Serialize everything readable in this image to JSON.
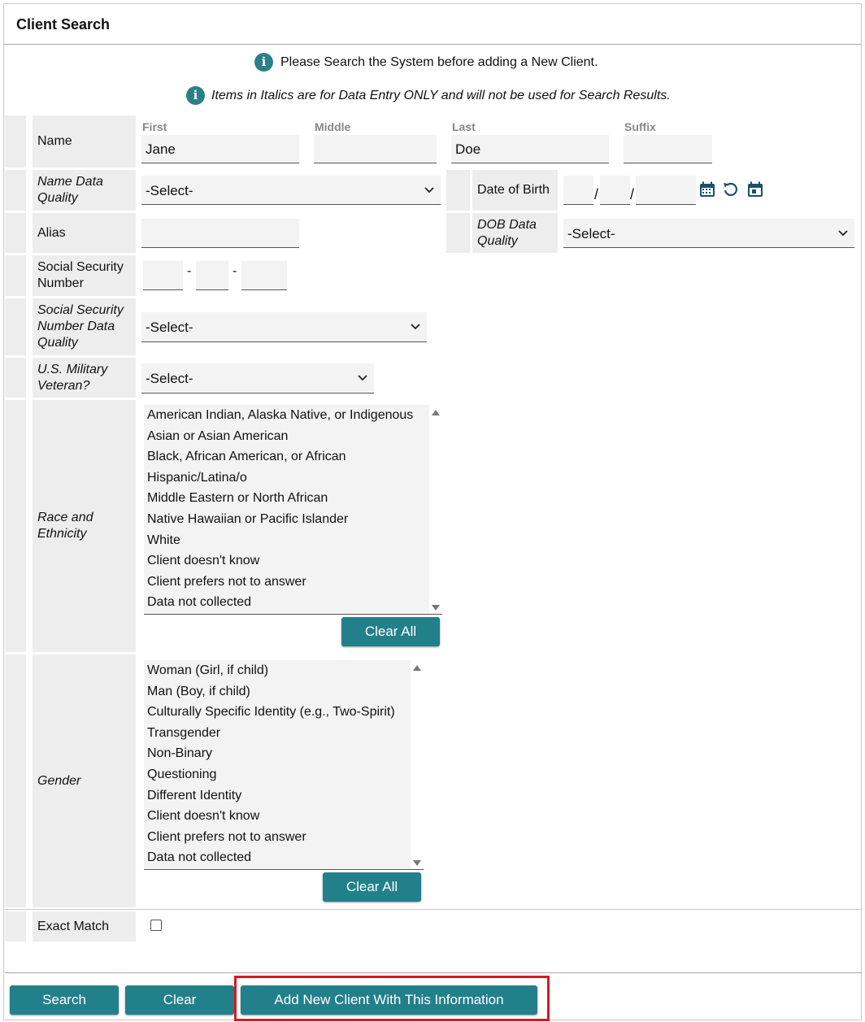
{
  "panel": {
    "title": "Client Search"
  },
  "info": {
    "search_notice": "Please Search the System before adding a New Client.",
    "italics_notice": "Items in Italics are for Data Entry ONLY and will not be used for Search Results."
  },
  "name": {
    "label": "Name",
    "first_label": "First",
    "first_value": "Jane",
    "middle_label": "Middle",
    "middle_value": "",
    "last_label": "Last",
    "last_value": "Doe",
    "suffix_label": "Suffix",
    "suffix_value": ""
  },
  "name_quality": {
    "label": "Name Data Quality",
    "value": "-Select-"
  },
  "dob": {
    "label": "Date of Birth",
    "month": "",
    "day": "",
    "year": ""
  },
  "alias": {
    "label": "Alias",
    "value": ""
  },
  "dob_quality": {
    "label": "DOB Data Quality",
    "value": "-Select-"
  },
  "ssn": {
    "label": "Social Security Number",
    "part1": "",
    "part2": "",
    "part3": "",
    "separator": "-"
  },
  "ssn_quality": {
    "label": "Social Security Number Data Quality",
    "value": "-Select-"
  },
  "veteran": {
    "label": "U.S. Military Veteran?",
    "value": "-Select-"
  },
  "race": {
    "label": "Race and Ethnicity",
    "options": [
      "American Indian, Alaska Native, or Indigenous",
      "Asian or Asian American",
      "Black, African American, or African",
      "Hispanic/Latina/o",
      "Middle Eastern or North African",
      "Native Hawaiian or Pacific Islander",
      "White",
      "Client doesn't know",
      "Client prefers not to answer",
      "Data not collected"
    ],
    "clear_label": "Clear All"
  },
  "gender": {
    "label": "Gender",
    "options": [
      "Woman (Girl, if child)",
      "Man (Boy, if child)",
      "Culturally Specific Identity (e.g., Two-Spirit)",
      "Transgender",
      "Non-Binary",
      "Questioning",
      "Different Identity",
      "Client doesn't know",
      "Client prefers not to answer",
      "Data not collected"
    ],
    "clear_label": "Clear All"
  },
  "exact_match": {
    "label": "Exact Match",
    "checked": false
  },
  "actions": {
    "search_label": "Search",
    "clear_label": "Clear",
    "add_label": "Add New Client With This Information"
  },
  "colors": {
    "accent": "#22808a",
    "highlight": "#d71920",
    "field_bg": "#f3f3f3",
    "label_bg": "#ededed"
  }
}
